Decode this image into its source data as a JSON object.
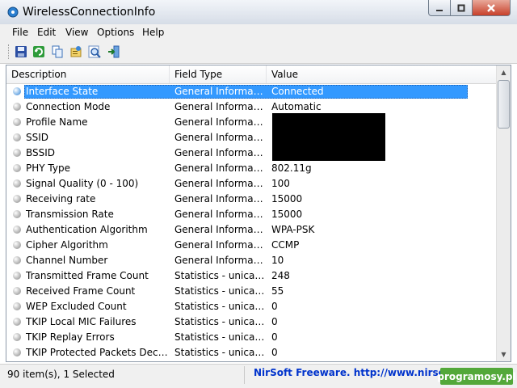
{
  "window": {
    "title": "WirelessConnectionInfo"
  },
  "menu": [
    "File",
    "Edit",
    "View",
    "Options",
    "Help"
  ],
  "columns": {
    "description": "Description",
    "field_type": "Field Type",
    "value": "Value"
  },
  "rows": [
    {
      "description": "Interface State",
      "field_type": "General Information",
      "value": "Connected",
      "selected": true
    },
    {
      "description": "Connection Mode",
      "field_type": "General Information",
      "value": "Automatic"
    },
    {
      "description": "Profile Name",
      "field_type": "General Information",
      "value": ""
    },
    {
      "description": "SSID",
      "field_type": "General Information",
      "value": ""
    },
    {
      "description": "BSSID",
      "field_type": "General Information",
      "value": ""
    },
    {
      "description": "PHY Type",
      "field_type": "General Information",
      "value": "802.11g"
    },
    {
      "description": "Signal Quality (0 - 100)",
      "field_type": "General Information",
      "value": "100"
    },
    {
      "description": "Receiving rate",
      "field_type": "General Information",
      "value": "15000"
    },
    {
      "description": "Transmission Rate",
      "field_type": "General Information",
      "value": "15000"
    },
    {
      "description": "Authentication Algorithm",
      "field_type": "General Information",
      "value": "WPA-PSK"
    },
    {
      "description": "Cipher Algorithm",
      "field_type": "General Information",
      "value": "CCMP"
    },
    {
      "description": "Channel Number",
      "field_type": "General Information",
      "value": "10"
    },
    {
      "description": "Transmitted Frame Count",
      "field_type": "Statistics - unicast ...",
      "value": "248"
    },
    {
      "description": "Received Frame Count",
      "field_type": "Statistics - unicast ...",
      "value": "55"
    },
    {
      "description": "WEP Excluded Count",
      "field_type": "Statistics - unicast ...",
      "value": "0"
    },
    {
      "description": "TKIP Local MIC Failures",
      "field_type": "Statistics - unicast ...",
      "value": "0"
    },
    {
      "description": "TKIP Replay Errors",
      "field_type": "Statistics - unicast ...",
      "value": "0"
    },
    {
      "description": "TKIP Protected Packets Decrypt...",
      "field_type": "Statistics - unicast ...",
      "value": "0"
    }
  ],
  "status": {
    "count": "90 item(s), 1 Selected",
    "link": "NirSoft Freeware.  http://www.nirsoft.net",
    "badge": "programosy.pl"
  },
  "toolbar_icons": [
    "save-icon",
    "refresh-icon",
    "copy-icon",
    "html-report-icon",
    "find-icon",
    "exit-icon"
  ],
  "colors": {
    "selection": "#3399ff",
    "link": "#0033cc",
    "badge": "#53a83a"
  }
}
